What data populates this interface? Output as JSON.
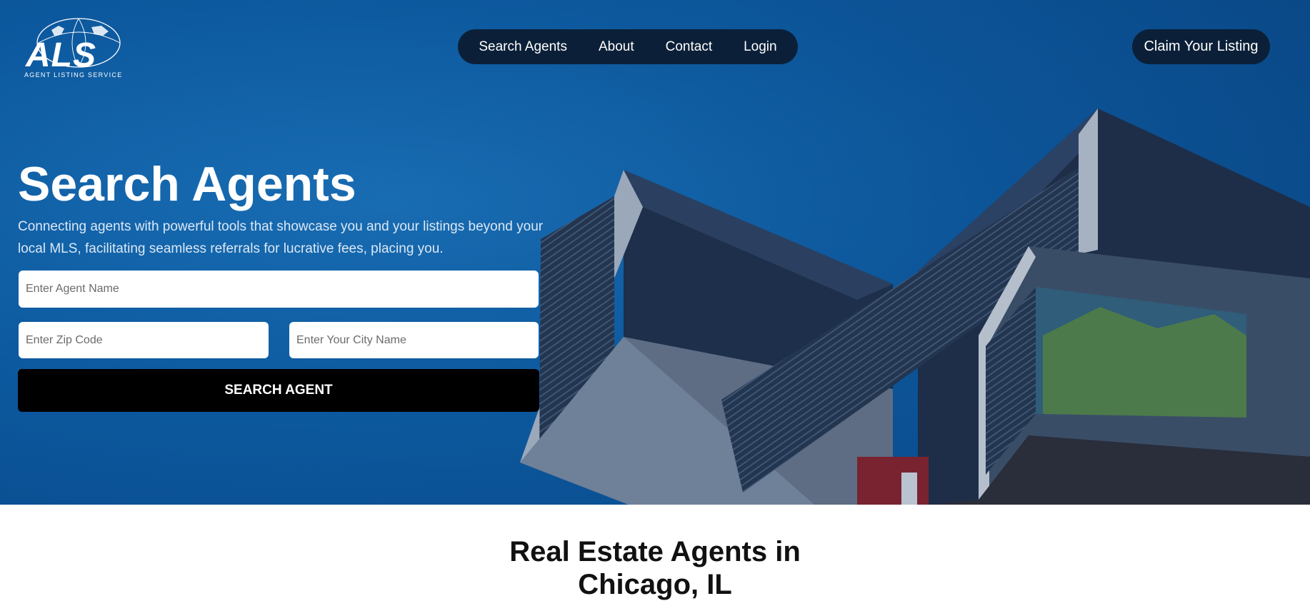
{
  "brand": {
    "logo_text": "ALS",
    "logo_subtitle": "AGENT LISTING SERVICE"
  },
  "nav": {
    "items": [
      {
        "label": "Search Agents"
      },
      {
        "label": "About"
      },
      {
        "label": "Contact"
      },
      {
        "label": "Login"
      }
    ]
  },
  "header": {
    "claim_label": "Claim Your Listing"
  },
  "hero": {
    "title": "Search Agents",
    "subtitle": "Connecting agents with powerful tools that showcase you and your listings beyond your local MLS, facilitating seamless referrals for lucrative fees, placing you."
  },
  "search": {
    "agent_name_placeholder": "Enter Agent Name",
    "zip_placeholder": "Enter Zip Code",
    "city_placeholder": "Enter Your City Name",
    "button_label": "SEARCH AGENT"
  },
  "section": {
    "title_line1": "Real Estate Agents in",
    "title_line2": "Chicago, IL"
  },
  "icons": {
    "logo_globe": "globe-icon"
  },
  "colors": {
    "hero_blue": "#0d5aa0",
    "nav_bg": "#0b2038",
    "button_bg": "#000000"
  }
}
